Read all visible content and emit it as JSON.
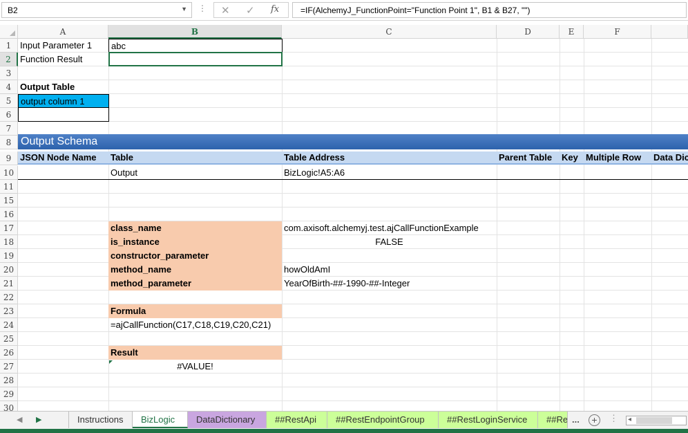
{
  "formula_bar": {
    "name_box": "B2",
    "fx_label": "fx",
    "formula": "=IF(AlchemyJ_FunctionPoint=\"Function Point 1\", B1 & B27, \"\")"
  },
  "columns": [
    "A",
    "B",
    "C",
    "D",
    "E",
    "F"
  ],
  "rows": [
    "1",
    "2",
    "3",
    "4",
    "5",
    "6",
    "7",
    "8",
    "9",
    "10",
    "11",
    "15",
    "16",
    "17",
    "18",
    "19",
    "20",
    "21",
    "22",
    "23",
    "24",
    "25",
    "26",
    "27",
    "28",
    "29",
    "30"
  ],
  "cells": {
    "a1": "Input Parameter 1",
    "b1": "abc",
    "a2": "Function Result",
    "a4": "Output Table",
    "a5": "output column 1",
    "schema_title": "Output Schema",
    "schema_headers": [
      "JSON Node Name",
      "Table",
      "Table Address",
      "Parent Table",
      "Key",
      "Multiple Row",
      "Data Dic"
    ],
    "b10": "Output",
    "c10": "BizLogic!A5:A6",
    "b17": "class_name",
    "c17": "com.axisoft.alchemyj.test.ajCallFunctionExample",
    "b18": "is_instance",
    "c18": "FALSE",
    "b19": "constructor_parameter",
    "b20": "method_name",
    "c20": "howOldAmI",
    "b21": "method_parameter",
    "c21": "YearOfBirth-##-1990-##-Integer",
    "b23": "Formula",
    "b24": "=ajCallFunction(C17,C18,C19,C20,C21)",
    "b26": "Result",
    "b27": "#VALUE!"
  },
  "sheet_tabs": [
    {
      "label": "Instructions",
      "color": "#f2f2f2"
    },
    {
      "label": "BizLogic",
      "color": "#ffffff",
      "active": true
    },
    {
      "label": "DataDictionary",
      "color": "#c9a6e0"
    },
    {
      "label": "##RestApi",
      "color": "#ccff99"
    },
    {
      "label": "##RestEndpointGroup",
      "color": "#ccff99"
    },
    {
      "label": "##RestLoginService",
      "color": "#ccff99"
    },
    {
      "label": "##Re",
      "color": "#ccff99"
    }
  ],
  "more_tabs": "...",
  "colors": {
    "accent": "#217346",
    "peach": "#f8cbad",
    "cyan": "#00b0f0",
    "schema_band": "#2d62ac",
    "schema_header": "#c5d9f1"
  }
}
